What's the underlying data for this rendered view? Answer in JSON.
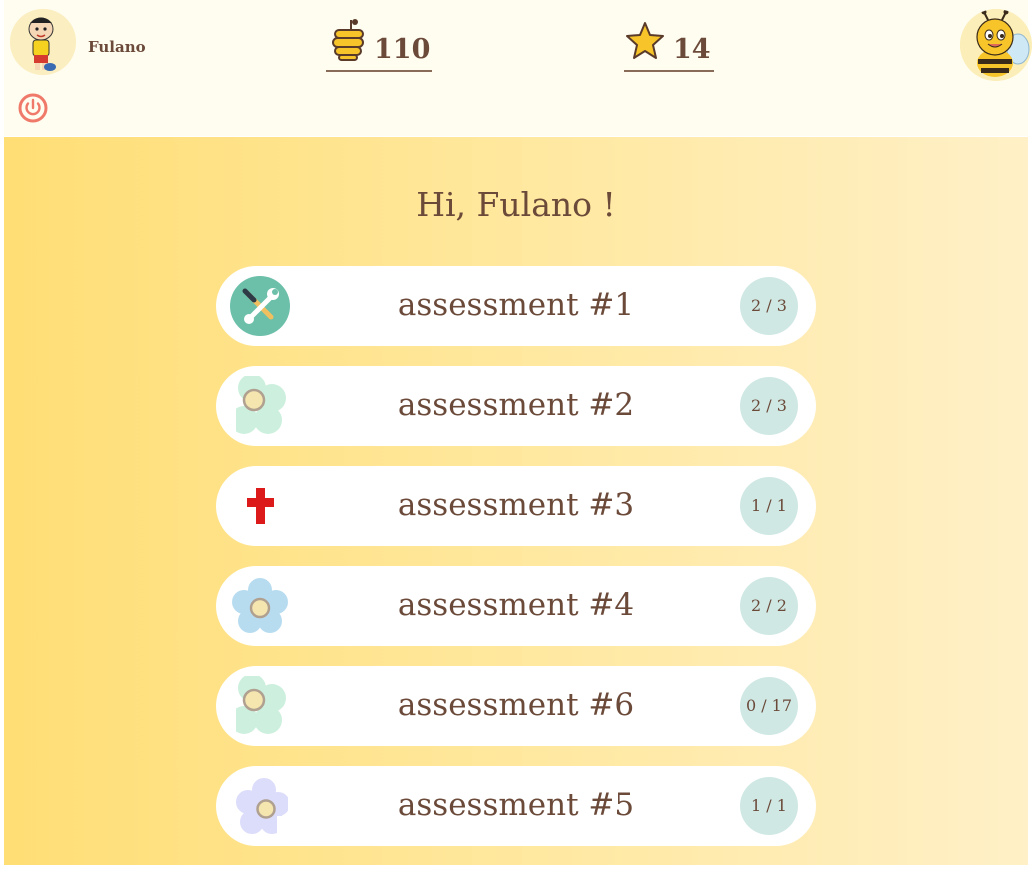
{
  "header": {
    "user_name": "Fulano",
    "honey_count": "110",
    "star_count": "14"
  },
  "greeting": "Hi, Fulano !",
  "assessments": [
    {
      "title": "assessment #1",
      "progress": "2 / 3",
      "icon": "tools-icon"
    },
    {
      "title": "assessment #2",
      "progress": "2 / 3",
      "icon": "flower-mint-icon"
    },
    {
      "title": "assessment #3",
      "progress": "1 / 1",
      "icon": "red-cross-icon"
    },
    {
      "title": "assessment #4",
      "progress": "2 / 2",
      "icon": "flower-blue-icon"
    },
    {
      "title": "assessment #6",
      "progress": "0 / 17",
      "icon": "flower-mint-icon"
    },
    {
      "title": "assessment #5",
      "progress": "1 / 1",
      "icon": "flower-lavender-icon"
    }
  ],
  "colors": {
    "text": "#6b4a3a",
    "badge": "#cfe8e4",
    "background_left": "#ffde75",
    "background_right": "#fff0c7",
    "power": "#f07a6a"
  }
}
